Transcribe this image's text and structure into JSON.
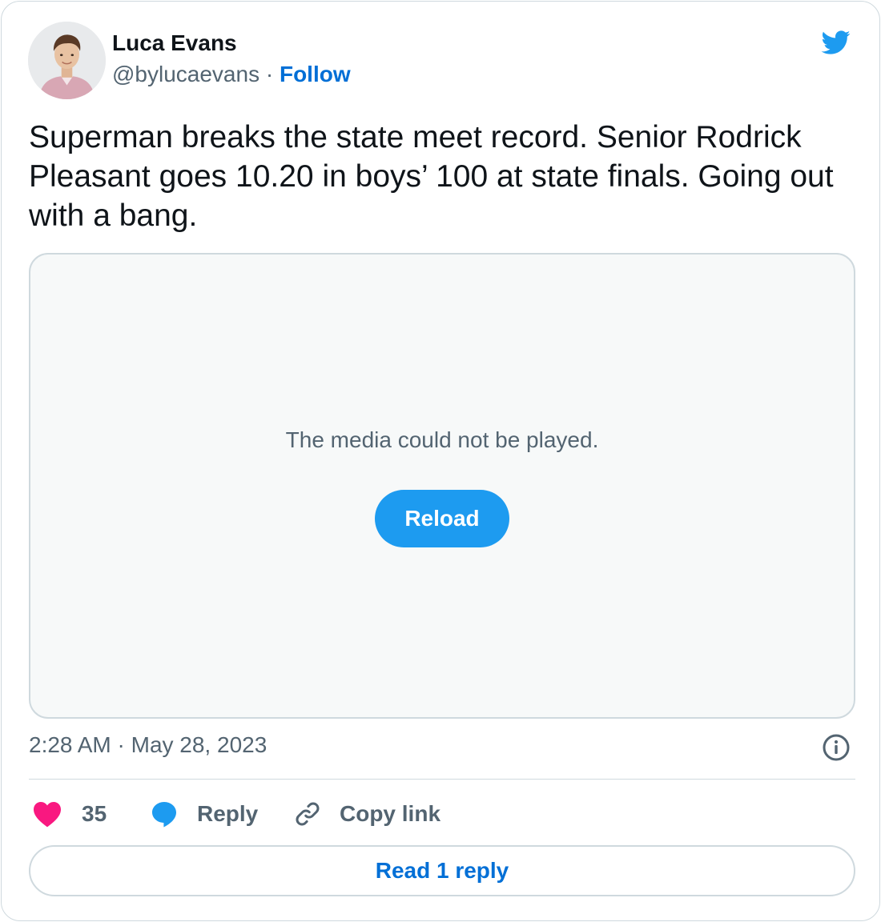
{
  "author": {
    "name": "Luca Evans",
    "handle": "@bylucaevans",
    "separator": "·",
    "follow_label": "Follow"
  },
  "tweet": {
    "text": "Superman breaks the state meet record. Senior Rodrick Pleasant goes 10.20 in boys’ 100 at state finals. Going out with a bang.",
    "timestamp": "2:28 AM · May 28, 2023"
  },
  "media": {
    "error_message": "The media could not be played.",
    "reload_label": "Reload"
  },
  "actions": {
    "like_count": "35",
    "reply_label": "Reply",
    "copy_link_label": "Copy link"
  },
  "footer": {
    "read_replies_label": "Read 1 reply"
  },
  "icons": {
    "brand": "twitter-bird-icon",
    "info": "info-icon",
    "like": "heart-icon",
    "reply": "speech-bubble-icon",
    "copy": "link-icon"
  },
  "colors": {
    "accent": "#1d9bf0",
    "link": "#006fd6",
    "like": "#f91880",
    "muted_text": "#536471",
    "border": "#cfd9de",
    "media_bg": "#f7f9f9"
  }
}
